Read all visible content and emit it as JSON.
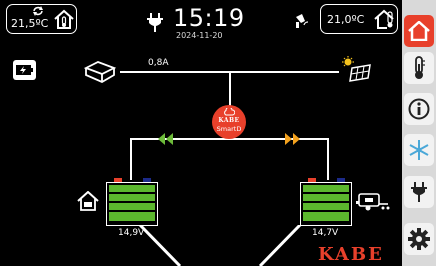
{
  "header": {
    "inside_temp": "21,5ºC",
    "time": "15:19",
    "date": "2024-11-20",
    "outside_temp": "21,0ºC"
  },
  "diagram": {
    "solar_current": "0,8A",
    "smartd_logo": "KABE",
    "smartd_label": "SmartD",
    "battery_left_voltage": "14,9V",
    "battery_right_voltage": "14,7V"
  },
  "brand": {
    "logo_text": "KABE"
  },
  "colors": {
    "accent": "#e8402b",
    "battery_green": "#5cb82e",
    "arrow_green": "#6dbb3a",
    "arrow_orange": "#f4a21e"
  },
  "sidebar": {
    "items": [
      {
        "name": "home-icon",
        "active": true
      },
      {
        "name": "thermometer-icon",
        "active": false
      },
      {
        "name": "info-icon",
        "active": false
      },
      {
        "name": "snowflake-icon",
        "active": false
      },
      {
        "name": "power-plug-icon",
        "active": false
      },
      {
        "name": "gear-icon",
        "active": false
      }
    ]
  }
}
